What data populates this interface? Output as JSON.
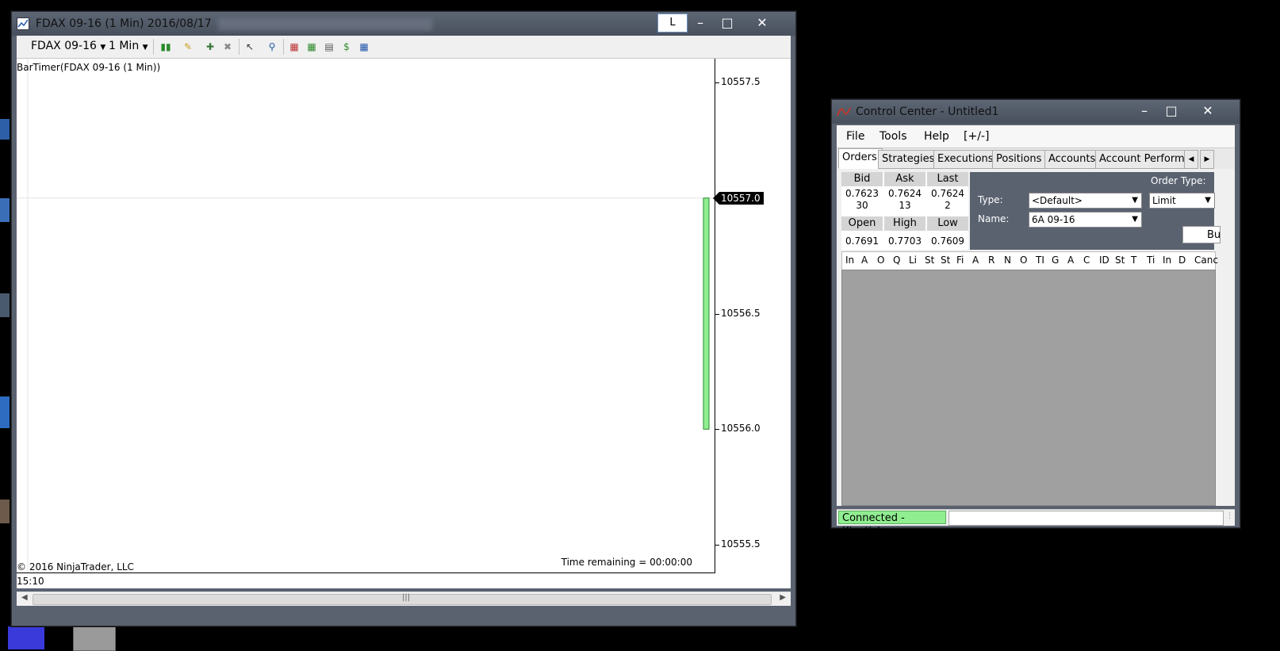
{
  "chart_window": {
    "title": "FDAX 09-16 (1 Min)  2016/08/17",
    "lock_label": "L",
    "toolbar": {
      "instrument": "FDAX 09-16",
      "interval": "1 Min"
    },
    "indicator_label": "BarTimer(FDAX 09-16 (1 Min))",
    "copyright": "© 2016 NinjaTrader, LLC",
    "time_remaining": "Time remaining = 00:00:00",
    "x_tick": "15:10",
    "current_price": "10557.0",
    "y_ticks": [
      "10557.5",
      "10556.5",
      "10556.0",
      "10555.5"
    ],
    "bar": {
      "open": 10556.0,
      "close": 10557.0,
      "color": "#90ee90"
    },
    "y_range": [
      10555.5,
      10557.5
    ]
  },
  "control_center": {
    "title": "Control Center - Untitled1",
    "menu": [
      "File",
      "Tools",
      "Help",
      "[+/-]"
    ],
    "tabs": [
      "Orders",
      "Strategies",
      "Executions",
      "Positions",
      "Accounts",
      "Account Performar"
    ],
    "quote": {
      "bid_label": "Bid",
      "ask_label": "Ask",
      "last_label": "Last",
      "bid": "0.7623",
      "ask": "0.7624",
      "last": "0.7624",
      "bid_size": "30",
      "ask_size": "13",
      "last_size": "2",
      "open_label": "Open",
      "high_label": "High",
      "low_label": "Low",
      "open": "0.7691",
      "high": "0.7703",
      "low": "0.7609"
    },
    "order_entry": {
      "type_label": "Type:",
      "type_value": "<Default>",
      "name_label": "Name:",
      "name_value": "6A 09-16",
      "order_type_label": "Order Type:",
      "order_type_value": "Limit",
      "buy_label": "Bu"
    },
    "columns": [
      "In",
      "A",
      "O",
      "Q",
      "Li",
      "St",
      "St",
      "Fi",
      "A",
      "R",
      "N",
      "O",
      "TI",
      "G",
      "A",
      "C",
      "ID",
      "St",
      "T",
      "Ti",
      "In",
      "D",
      "Canc"
    ],
    "status": "Connected - Kinetick"
  }
}
